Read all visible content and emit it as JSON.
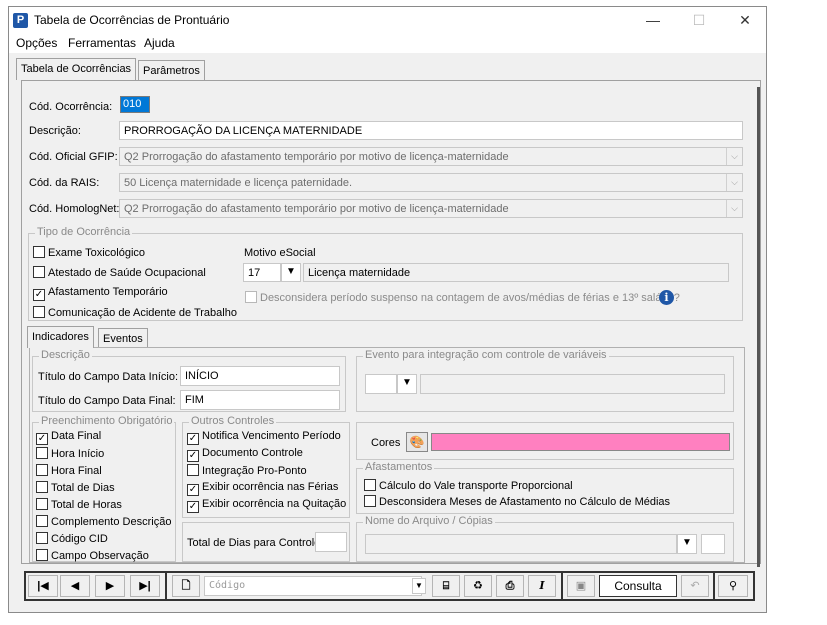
{
  "window": {
    "title": "Tabela de Ocorrências de Prontuário",
    "app_icon": "P"
  },
  "menu": {
    "opcoes": "Opções",
    "ferramentas": "Ferramentas",
    "ajuda": "Ajuda"
  },
  "tabs": {
    "ocorrencias": "Tabela de Ocorrências",
    "parametros": "Parâmetros"
  },
  "form": {
    "cod_ocorrencia_label": "Cód. Ocorrência:",
    "cod_ocorrencia_value": "010",
    "descricao_label": "Descrição:",
    "descricao_value": "PRORROGAÇÃO DA LICENÇA MATERNIDADE",
    "gfip_label": "Cód. Oficial GFIP:",
    "gfip_value": "Q2 Prorrogação do afastamento temporário por motivo de licença-maternidade",
    "rais_label": "Cód. da RAIS:",
    "rais_value": "50 Licença maternidade e licença paternidade.",
    "homolognet_label": "Cód. HomologNet:",
    "homolognet_value": "Q2  Prorrogação do afastamento temporário por motivo de licença-maternidade"
  },
  "tipo": {
    "title": "Tipo de Ocorrência",
    "items": [
      {
        "label": "Exame Toxicológico",
        "checked": false
      },
      {
        "label": "Atestado de Saúde Ocupacional",
        "checked": false
      },
      {
        "label": "Afastamento Temporário",
        "checked": true
      },
      {
        "label": "Comunicação de Acidente de Trabalho",
        "checked": false
      }
    ],
    "motivo_label": "Motivo eSocial",
    "motivo_code": "17",
    "motivo_desc": "Licença maternidade",
    "desconsidera": "Desconsidera período suspenso na contagem de avos/médias de férias e 13º salário?"
  },
  "subtabs": {
    "indicadores": "Indicadores",
    "eventos": "Eventos"
  },
  "descricao_group": {
    "title": "Descrição",
    "inicio_label": "Título do Campo Data Início:",
    "inicio_value": "INÍCIO",
    "final_label": "Título do Campo Data Final:",
    "final_value": "FIM"
  },
  "evento_group": {
    "title": "Evento para integração com controle de variáveis"
  },
  "preenchimento": {
    "title": "Preenchimento Obrigatório",
    "items": [
      {
        "label": "Data Final",
        "checked": true
      },
      {
        "label": "Hora Início",
        "checked": false
      },
      {
        "label": "Hora Final",
        "checked": false
      },
      {
        "label": "Total de Dias",
        "checked": false
      },
      {
        "label": "Total de Horas",
        "checked": false
      },
      {
        "label": "Complemento Descrição",
        "checked": false
      },
      {
        "label": "Código CID",
        "checked": false
      },
      {
        "label": "Campo Observação",
        "checked": false
      }
    ]
  },
  "outros": {
    "title": "Outros Controles",
    "items": [
      {
        "label": "Notifica Vencimento Período",
        "checked": true
      },
      {
        "label": "Documento Controle",
        "checked": true
      },
      {
        "label": "Integração Pro-Ponto",
        "checked": false
      },
      {
        "label": "Exibir ocorrência nas Férias",
        "checked": true
      },
      {
        "label": "Exibir ocorrência na Quitação",
        "checked": true
      }
    ],
    "total_dias_label": "Total de Dias para Controle:"
  },
  "cores": {
    "label": "Cores",
    "color": "#ff80c0"
  },
  "afastamentos": {
    "title": "Afastamentos",
    "items": [
      {
        "label": "Cálculo do Vale transporte Proporcional",
        "checked": false
      },
      {
        "label": "Desconsidera Meses de Afastamento no Cálculo de Médias",
        "checked": false
      }
    ]
  },
  "arquivo": {
    "title": "Nome do Arquivo / Cópias"
  },
  "toolbar": {
    "first": "|◀",
    "prev": "◀",
    "next": "▶",
    "last": "▶|",
    "search_placeholder": "Código",
    "consulta": "Consulta",
    "italic": "I"
  }
}
